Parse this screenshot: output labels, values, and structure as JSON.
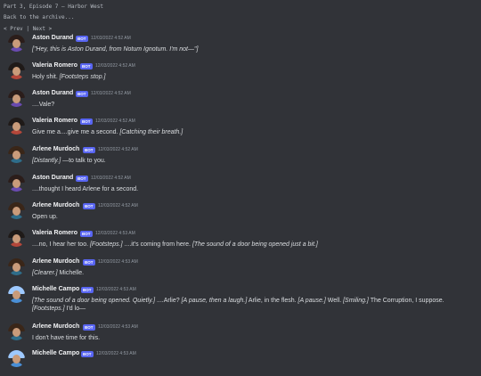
{
  "header": {
    "title": "Part 3, Episode 7 — Harbor West",
    "back_link": "Back to the archive...",
    "prev_label": "< Prev",
    "separator": "|",
    "next_label": "Next >"
  },
  "bot_badge": "BOT",
  "messages": [
    {
      "author": "Aston Durand",
      "timestamp": "12/03/2022 4:52 AM",
      "text": "[\"Hey, this is Aston Durand, from Notum Ignotum. I'm not—\"]"
    },
    {
      "author": "Valeria Romero",
      "timestamp": "12/03/2022 4:52 AM",
      "text": "Holy shit. [Footsteps stop.]"
    },
    {
      "author": "Aston Durand",
      "timestamp": "12/03/2022 4:52 AM",
      "text": "....Vale?"
    },
    {
      "author": "Valeria Romero",
      "timestamp": "12/03/2022 4:52 AM",
      "text": "Give me a....give me a second. [Catching their breath.]"
    },
    {
      "author": "Arlene Murdoch",
      "timestamp": "12/03/2022 4:52 AM",
      "text": "[Distantly.] —to talk to you."
    },
    {
      "author": "Aston Durand",
      "timestamp": "12/03/2022 4:52 AM",
      "text": "....thought I heard Arlene for a second."
    },
    {
      "author": "Arlene Murdoch",
      "timestamp": "12/03/2022 4:52 AM",
      "text": "Open up."
    },
    {
      "author": "Valeria Romero",
      "timestamp": "12/03/2022 4:53 AM",
      "text": "....no, I hear her too. [Footsteps.] ....it's coming from here. [The sound of a door being opened just a bit.]"
    },
    {
      "author": "Arlene Murdoch",
      "timestamp": "12/03/2022 4:53 AM",
      "text": "[Clearer.] Michelle."
    },
    {
      "author": "Michelle Campo",
      "timestamp": "12/03/2022 4:53 AM",
      "text": "[The sound of a door being opened. Quietly.] ....Arlie? [A pause, then a laugh.] Arlie, in the flesh. [A pause.] Well. [Smiling.] The Corruption, I suppose. [Footsteps.] I'd lo—"
    },
    {
      "author": "Arlene Murdoch",
      "timestamp": "12/03/2022 4:53 AM",
      "text": "I don't have time for this."
    },
    {
      "author": "Michelle Campo",
      "timestamp": "12/03/2022 4:53 AM",
      "text": ""
    }
  ],
  "avatar_colors": {
    "Aston Durand": {
      "hair": "#2b1d1a",
      "shirt": "#6a4bb0"
    },
    "Valeria Romero": {
      "hair": "#1f1a18",
      "shirt": "#b5473a"
    },
    "Arlene Murdoch": {
      "hair": "#3a2618",
      "shirt": "#2f6d8a"
    },
    "Michelle Campo": {
      "hair": "#9ec9ff",
      "shirt": "#4a8fd6"
    }
  }
}
